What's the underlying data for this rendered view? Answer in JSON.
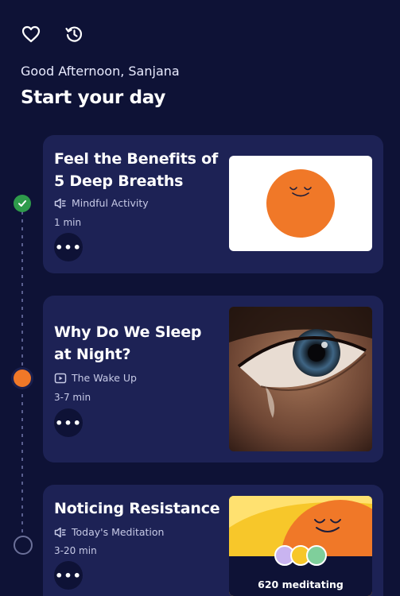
{
  "greeting": "Good Afternoon, Sanjana",
  "headline": "Start your day",
  "icons": {
    "favorite": "heart-icon",
    "history": "history-icon"
  },
  "colors": {
    "background": "#0e1236",
    "card": "#1d2255",
    "accent_orange": "#f07828",
    "done_green": "#2e9b4b",
    "thumb_yellow": "#f7c72a"
  },
  "cards": [
    {
      "title": "Feel the Benefits of 5 Deep Breaths",
      "type_icon": "audio-icon",
      "type_label": "Mindful Activity",
      "duration": "1 min",
      "more_label": "•••",
      "status": "completed"
    },
    {
      "title": "Why Do We Sleep at Night?",
      "type_icon": "video-icon",
      "type_label": "The Wake Up",
      "duration": "3-7 min",
      "more_label": "•••",
      "status": "current"
    },
    {
      "title": "Noticing Resistance",
      "type_icon": "audio-icon",
      "type_label": "Today's Meditation",
      "duration": "3-20 min",
      "more_label": "•••",
      "status": "upcoming",
      "meditating": "620 meditating"
    }
  ]
}
